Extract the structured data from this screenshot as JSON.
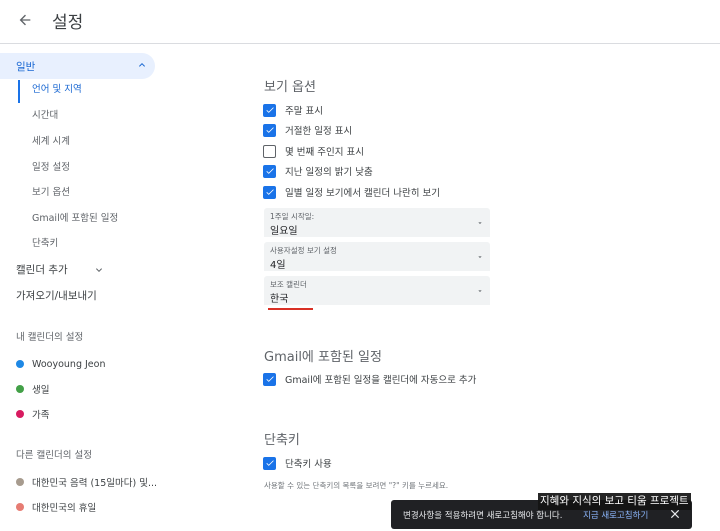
{
  "header": {
    "title": "설정"
  },
  "sidebar": {
    "general": "일반",
    "general_items": [
      "언어 및 지역",
      "시간대",
      "세계 시계",
      "일정 설정",
      "보기 옵션",
      "Gmail에 포함된 일정",
      "단축키"
    ],
    "add_calendar": "캘린더 추가",
    "import_export": "가져오기/내보내기",
    "my_calendars_header": "내 캘린더의 설정",
    "my_calendars": [
      {
        "name": "Wooyoung Jeon",
        "color": "#1e88e5"
      },
      {
        "name": "생일",
        "color": "#43a047"
      },
      {
        "name": "가족",
        "color": "#d81b60"
      }
    ],
    "other_calendars_header": "다른 캘린더의 설정",
    "other_calendars": [
      {
        "name": "대한민국 음력 (15일마다) 및...",
        "color": "#a79b8e"
      },
      {
        "name": "대한민국의 휴일",
        "color": "#e67c73"
      }
    ]
  },
  "view_options": {
    "title": "보기 옵션",
    "checkboxes": [
      {
        "label": "주말 표시",
        "checked": true
      },
      {
        "label": "거절한 일정 표시",
        "checked": true
      },
      {
        "label": "몇 번째 주인지 표시",
        "checked": false
      },
      {
        "label": "지난 일정의 밝기 낮춤",
        "checked": true
      },
      {
        "label": "일별 일정 보기에서 캘린더 나란히 보기",
        "checked": true
      }
    ],
    "selects": [
      {
        "label": "1주일 시작일:",
        "value": "일요일"
      },
      {
        "label": "사용자설정 보기 설정",
        "value": "4일"
      },
      {
        "label": "보조 캘린더",
        "value": "한국"
      }
    ]
  },
  "gmail_events": {
    "title": "Gmail에 포함된 일정",
    "checkbox": {
      "label": "Gmail에 포함된 일정을 캘린더에 자동으로 추가",
      "checked": true
    }
  },
  "shortcuts": {
    "title": "단축키",
    "checkbox": {
      "label": "단축키 사용",
      "checked": true
    },
    "hint": "사용할 수 있는 단축키의 목록을 보려면 \"?\" 키를 누르세요."
  },
  "toast": {
    "message": "변경사항을 적용하려면 새로고침해야 합니다.",
    "action": "지금 새로고침하기"
  },
  "watermark": "지혜와 지식의 보고 티움 프로젝트",
  "colors": {
    "accent": "#1a73e8",
    "active_bg": "#e8f0fe",
    "underline": "#d93025"
  }
}
